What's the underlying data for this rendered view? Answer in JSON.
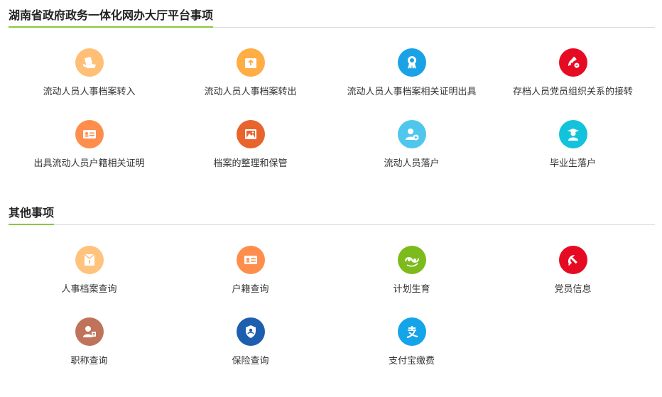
{
  "sections": [
    {
      "title": "湖南省政府政务一体化网办大厅平台事项",
      "items": [
        {
          "label": "流动人员人事档案转入",
          "icon": "handover-in-icon",
          "color": "#ffbf76"
        },
        {
          "label": "流动人员人事档案转出",
          "icon": "box-export-icon",
          "color": "#ffad45"
        },
        {
          "label": "流动人员人事档案相关证明出具",
          "icon": "award-ribbon-icon",
          "color": "#1aa2e6"
        },
        {
          "label": "存档人员党员组织关系的接转",
          "icon": "party-transfer-icon",
          "color": "#e60b23"
        },
        {
          "label": "出具流动人员户籍相关证明",
          "icon": "id-card-icon",
          "color": "#ff8d4c"
        },
        {
          "label": "档案的整理和保管",
          "icon": "picture-frame-icon",
          "color": "#e8642d"
        },
        {
          "label": "流动人员落户",
          "icon": "user-add-icon",
          "color": "#4fc7ec"
        },
        {
          "label": "毕业生落户",
          "icon": "graduate-icon",
          "color": "#13c3dc"
        }
      ]
    },
    {
      "title": "其他事项",
      "items": [
        {
          "label": "人事档案查询",
          "icon": "archive-envelope-icon",
          "color": "#ffc37e"
        },
        {
          "label": "户籍查询",
          "icon": "id-card-icon",
          "color": "#ff8d4c"
        },
        {
          "label": "计划生育",
          "icon": "family-planning-icon",
          "color": "#7dbb1d"
        },
        {
          "label": "党员信息",
          "icon": "hammer-sickle-icon",
          "color": "#e60b23"
        },
        {
          "label": "职称查询",
          "icon": "user-badge-icon",
          "color": "#c0735b"
        },
        {
          "label": "保险查询",
          "icon": "insurance-shield-icon",
          "color": "#1d5fae"
        },
        {
          "label": "支付宝缴费",
          "icon": "alipay-icon",
          "color": "#14a4ea"
        }
      ]
    }
  ]
}
